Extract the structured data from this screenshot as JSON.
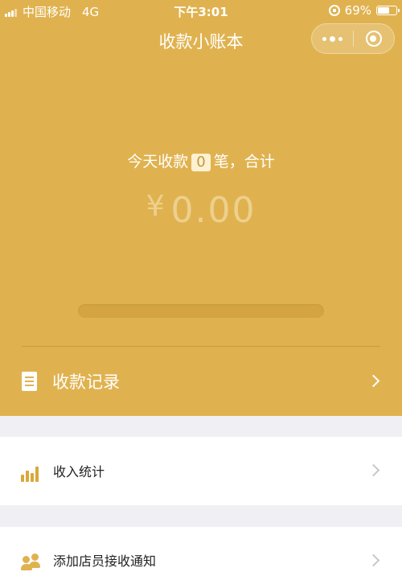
{
  "status_bar": {
    "carrier": "中国移动",
    "network": "4G",
    "time": "下午3:01",
    "battery": "69%",
    "battery_level": 0.69
  },
  "nav": {
    "title": "收款小账本",
    "more_icon": "more-dots-icon",
    "close_icon": "circle-close-icon"
  },
  "summary": {
    "prefix": "今天收款",
    "count": "0",
    "suffix": "笔，合计",
    "currency": "¥",
    "amount": "0.00"
  },
  "menu": {
    "records_label": "收款记录",
    "stats_label": "收入统计",
    "staff_label": "添加店员接收通知"
  },
  "colors": {
    "brand": "#e0b24f",
    "background": "#efeff4",
    "amount_text": "#edd08e"
  }
}
